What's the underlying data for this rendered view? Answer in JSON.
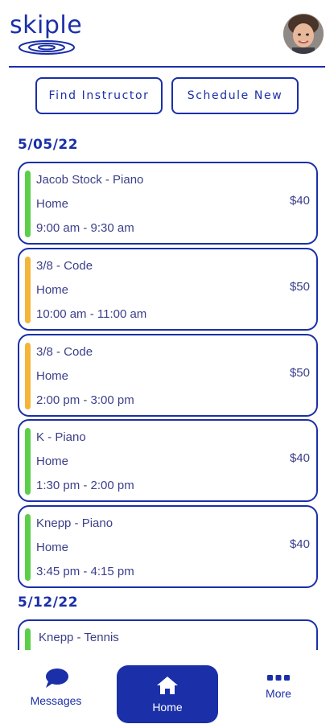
{
  "brand": {
    "logo_text": "skiple",
    "accent": "#1a2fa8"
  },
  "actions": {
    "find_instructor": "Find Instructor",
    "schedule_new": "Schedule New"
  },
  "dates": [
    "5/05/22",
    "5/12/22"
  ],
  "lessons": [
    {
      "title": "Jacob Stock - Piano",
      "location": "Home",
      "time": "9:00 am - 9:30 am",
      "price": "$40",
      "status_color": "#5ccf4a"
    },
    {
      "title": "3/8 - Code",
      "location": "Home",
      "time": "10:00 am - 11:00 am",
      "price": "$50",
      "status_color": "#f4b53a"
    },
    {
      "title": "3/8 - Code",
      "location": "Home",
      "time": "2:00 pm - 3:00 pm",
      "price": "$50",
      "status_color": "#f4b53a"
    },
    {
      "title": "K - Piano",
      "location": "Home",
      "time": "1:30 pm - 2:00 pm",
      "price": "$40",
      "status_color": "#5ccf4a"
    },
    {
      "title": "Knepp - Piano",
      "location": "Home",
      "time": "3:45 pm - 4:15 pm",
      "price": "$40",
      "status_color": "#5ccf4a"
    },
    {
      "title": "Knepp - Tennis",
      "status_color": "#5ccf4a"
    }
  ],
  "nav": {
    "messages": "Messages",
    "home": "Home",
    "more": "More"
  },
  "icons": {
    "messages": "chat-bubble-icon",
    "home": "house-icon",
    "more": "ellipsis-icon"
  }
}
